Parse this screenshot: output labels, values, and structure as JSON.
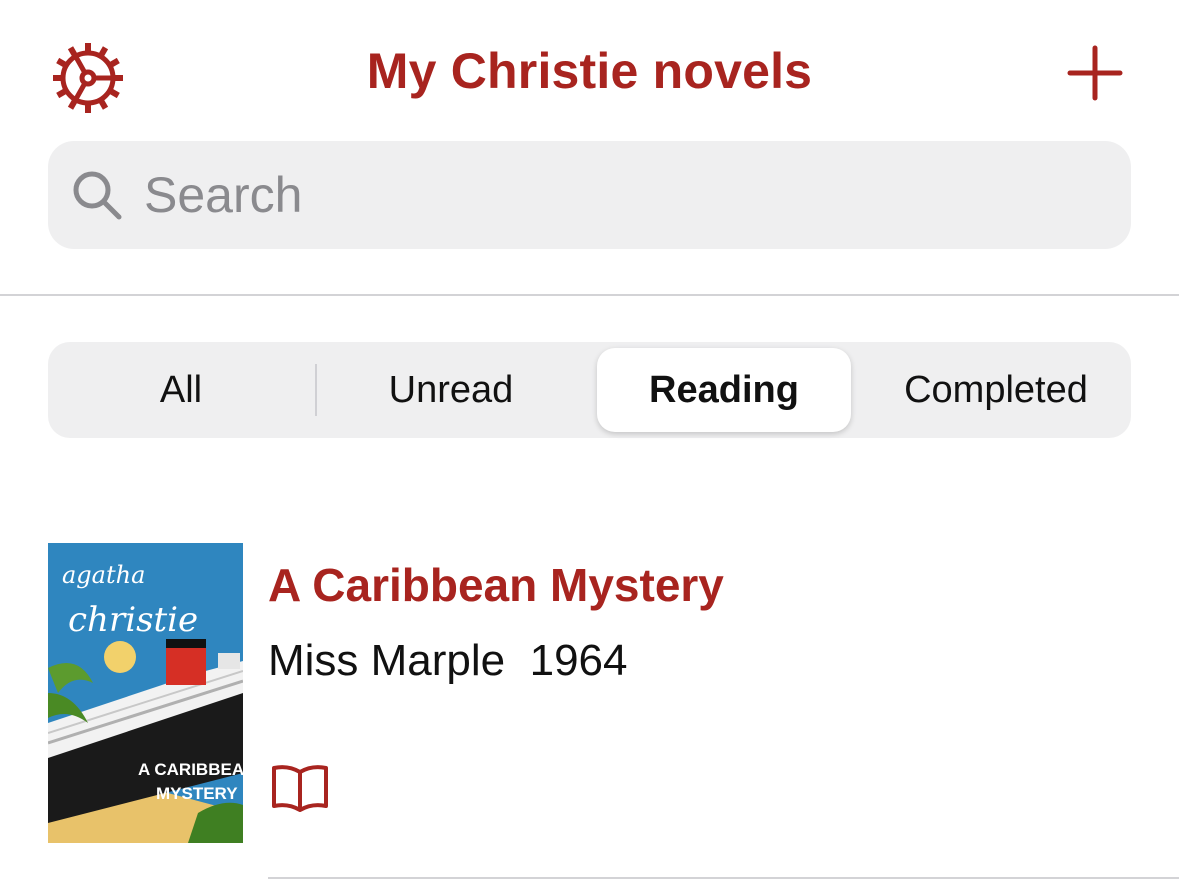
{
  "nav": {
    "title": "My Christie novels",
    "settings_icon": "gear-icon",
    "add_icon": "plus-icon"
  },
  "search": {
    "placeholder": "Search",
    "value": "",
    "icon": "magnifying-glass-icon"
  },
  "filter": {
    "segments": [
      "All",
      "Unread",
      "Reading",
      "Completed"
    ],
    "selected": "Reading"
  },
  "books": [
    {
      "title": "A Caribbean Mystery",
      "subtitle": "Miss Marple  1964",
      "cover": {
        "author_script": "agatha christie",
        "title_lines": [
          "A CARIBBEAN",
          "MYSTERY"
        ]
      },
      "status_icon": "open-book-icon"
    }
  ],
  "colors": {
    "accent": "#a8241f",
    "search_bg": "#efeff0",
    "divider": "#d3d3d6"
  }
}
